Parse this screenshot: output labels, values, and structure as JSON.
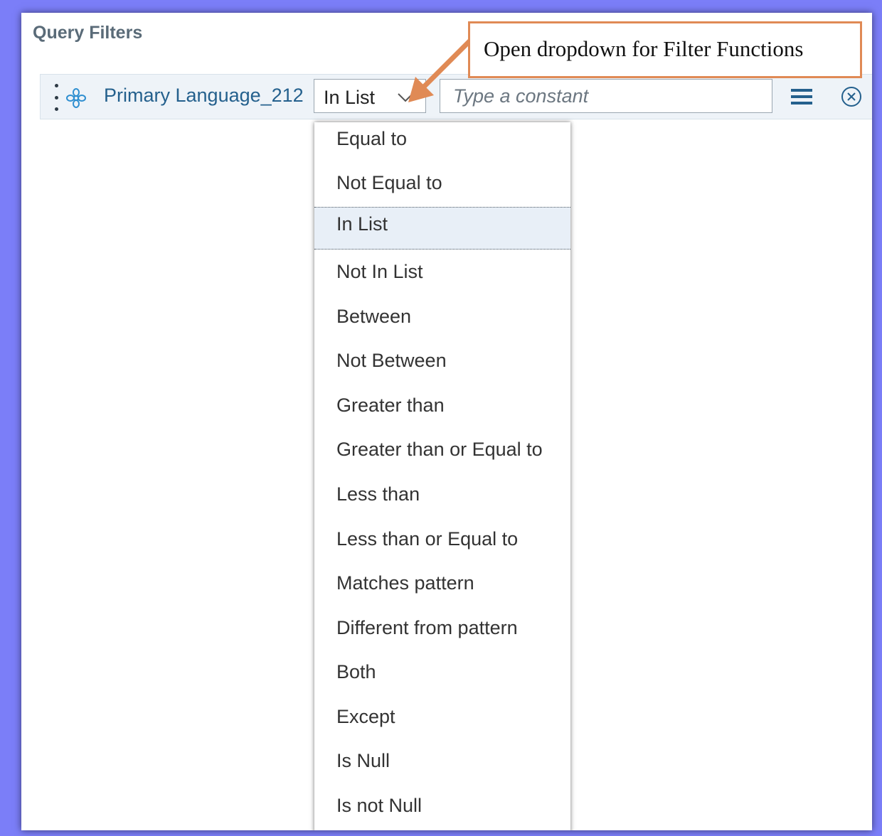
{
  "panel": {
    "title": "Query Filters"
  },
  "filter": {
    "field_name": "Primary Language_212",
    "operator": "In List",
    "constant_placeholder": "Type a constant"
  },
  "dropdown": {
    "options": [
      "Equal to",
      "Not Equal to",
      "In List",
      "Not In List",
      "Between",
      "Not Between",
      "Greater than",
      "Greater than or Equal to",
      "Less than",
      "Less than or Equal to",
      "Matches pattern",
      "Different from pattern",
      "Both",
      "Except",
      "Is Null",
      "Is not Null"
    ],
    "selected": "In List"
  },
  "callout": {
    "text": "Open dropdown for Filter Functions"
  },
  "icons": {
    "drag": "drag-handle-icon",
    "dimension": "dimension-icon",
    "chevron": "chevron-down-icon",
    "menu": "menu-icon",
    "close": "close-circle-icon"
  },
  "colors": {
    "background": "#7b7ef8",
    "field_name": "#24608d",
    "callout_border": "#e08a55",
    "selected_option": "#e8eff7"
  }
}
